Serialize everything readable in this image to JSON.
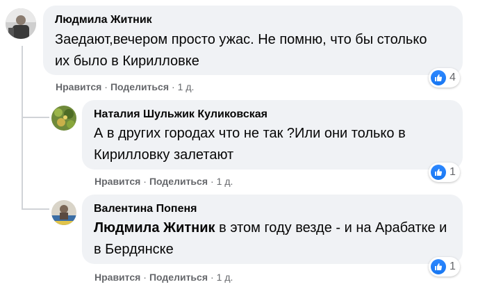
{
  "comments": [
    {
      "author": "Людмила Житник",
      "text": "Заедают,вечером просто ужас. Не помню, что бы столько их было в Кирилловке",
      "actions": {
        "like": "Нравится",
        "share": "Поделиться",
        "time": "1 д."
      },
      "reactions": {
        "icon": "like-icon",
        "count": "4"
      }
    },
    {
      "author": "Наталия Шульжик Куликовская",
      "text": "А в других городах что не так ?Или они только в Кирилловку залетают",
      "actions": {
        "like": "Нравится",
        "share": "Поделиться",
        "time": "1 д."
      },
      "reactions": {
        "icon": "like-icon",
        "count": "1"
      }
    },
    {
      "author": "Валентина Попеня",
      "mention": "Людмила Житник",
      "text": " в этом году везде - и на Арабатке и в Бердянске",
      "actions": {
        "like": "Нравится",
        "share": "Поделиться",
        "time": "1 д."
      },
      "reactions": {
        "icon": "like-icon",
        "count": "1"
      }
    }
  ],
  "separator": "·",
  "colors": {
    "bubble": "#f0f2f5",
    "secondary_text": "#65676b",
    "like_blue": "#1877f2"
  }
}
